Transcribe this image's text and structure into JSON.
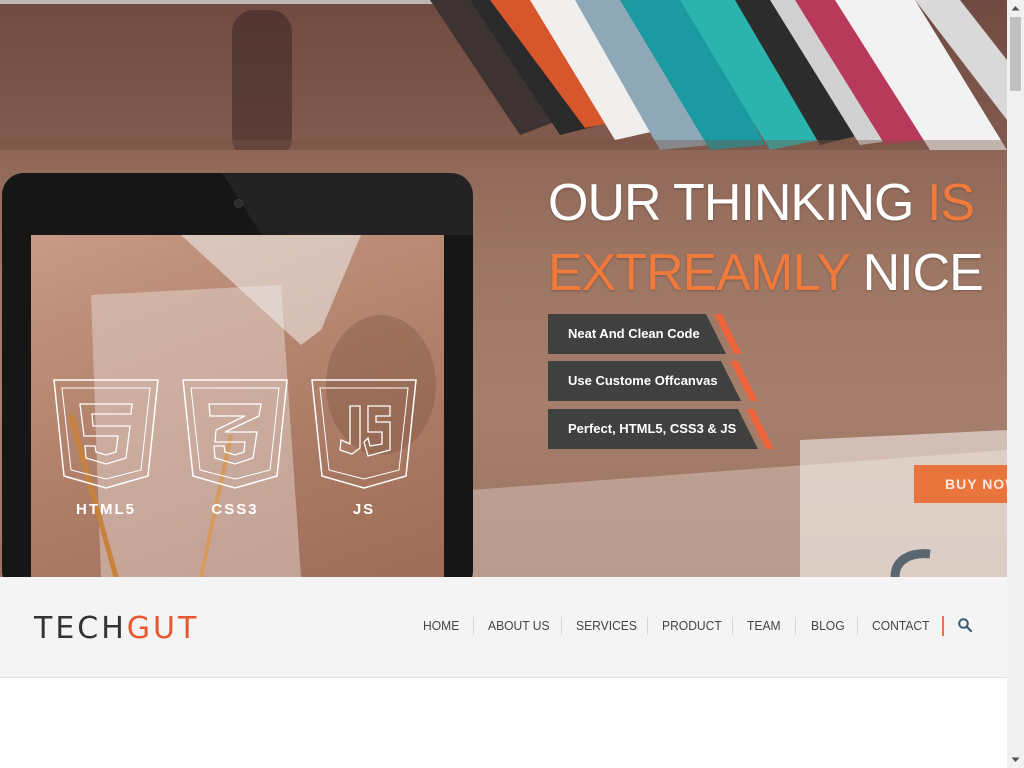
{
  "hero": {
    "line1_white": "OUR THINKING",
    "line1_orange": "IS",
    "line2_orange": "EXTREAMLY",
    "line2_white": "NICE",
    "features": [
      "Neat And Clean Code",
      "Use Custome Offcanvas",
      "Perfect, HTML5, CSS3 & JS"
    ],
    "buy_button": "BUY NOW",
    "tech_badges": [
      "HTML5",
      "CSS3",
      "JS"
    ]
  },
  "nav": {
    "logo_part1": "TECH",
    "logo_part2": "GUT",
    "items": [
      "HOME",
      "ABOUT US",
      "SERVICES",
      "PRODUCT",
      "TEAM",
      "BLOG",
      "CONTACT"
    ],
    "search_icon": "search-icon"
  },
  "colors": {
    "accent": "#e9743c",
    "logo_accent": "#e8572e",
    "ribbon": "#404040",
    "nav_background": "#f4f4f4"
  }
}
